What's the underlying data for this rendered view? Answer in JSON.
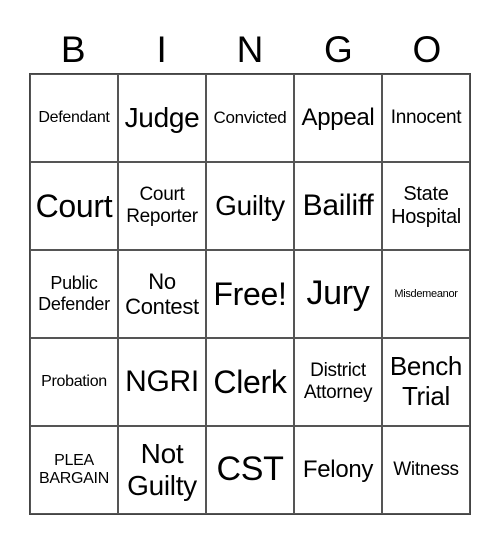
{
  "header": {
    "letters": [
      "B",
      "I",
      "N",
      "G",
      "O"
    ]
  },
  "cells": [
    [
      "Defendant",
      "Judge",
      "Convicted",
      "Appeal",
      "Innocent"
    ],
    [
      "Court",
      "Court\nReporter",
      "Guilty",
      "Bailiff",
      "State\nHospital"
    ],
    [
      "Public\nDefender",
      "No\nContest",
      "Free!",
      "Jury",
      "Misdemeanor"
    ],
    [
      "Probation",
      "NGRI",
      "Clerk",
      "District\nAttorney",
      "Bench\nTrial"
    ],
    [
      "PLEA\nBARGAIN",
      "Not\nGuilty",
      "CST",
      "Felony",
      "Witness"
    ]
  ]
}
